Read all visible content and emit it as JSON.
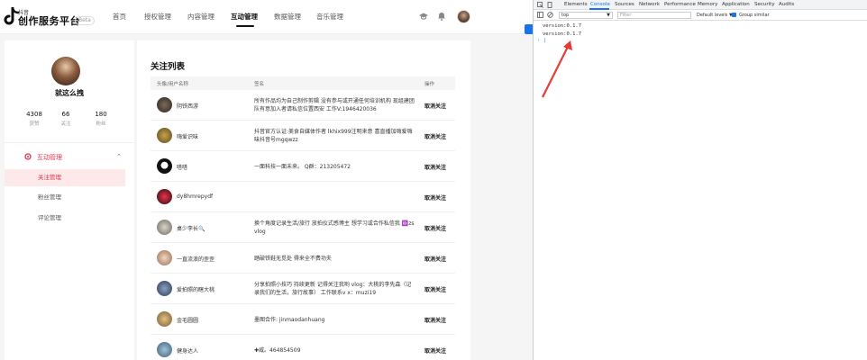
{
  "brand": {
    "small": "抖音",
    "title": "创作服务平台",
    "badge": "Beta"
  },
  "nav": {
    "items": [
      "首页",
      "授权管理",
      "内容管理",
      "互动管理",
      "数据管理",
      "音乐管理"
    ],
    "active_index": 3
  },
  "topbar_icons": [
    "graduation-cap-icon",
    "bell-icon"
  ],
  "profile": {
    "name": "就这么拽",
    "stats": [
      {
        "value": "4308",
        "label": "获赞"
      },
      {
        "value": "66",
        "label": "关注"
      },
      {
        "value": "180",
        "label": "粉丝"
      }
    ]
  },
  "sidemenu": {
    "head": "互动管理",
    "items": [
      "关注管理",
      "粉丝管理",
      "评论管理"
    ],
    "active_index": 0
  },
  "main": {
    "title": "关注列表",
    "headers": {
      "avatar": "头像/用户名称",
      "signature": "签名",
      "action": "操作"
    },
    "rows": [
      {
        "name": "阴铁西游",
        "signature": "所有作品均为自己制作剪辑 没有参与或开通任何培训机构 现组建团队有意加入者请私信位置西安 工作V:1946420036",
        "action": "取消关注"
      },
      {
        "name": "嗨爱识味",
        "signature": "抖音官方认证:美食自媒体作者 lkhix999注明来意 喜直播加嗨爱嗨味抖音号mgqwzz",
        "action": "取消关注"
      },
      {
        "name": "嗒嗒",
        "signature": "一面科技一面未来。 Q群：213205472",
        "action": "取消关注"
      },
      {
        "name": "dy8hmrepydf",
        "signature": "",
        "action": "取消关注"
      },
      {
        "name": "桌少李长🔍",
        "signature": "换个角度记录生活/旅行 放拍仪式感博主 想学习或合作私信我 🆔zsvlog",
        "action": "取消关注"
      },
      {
        "name": "一直流浪的歪歪",
        "signature": "踏破铁鞋无觅处 得来全不费功夫",
        "action": "取消关注"
      },
      {
        "name": "爱拍照的瞎大桃",
        "signature": "分享拍照小技巧 持续更新 记得关注我哟 vlog：大桃的李先森（记录我们的生活，旅行故事） 工作联系v x：muzi19",
        "action": "取消关注"
      },
      {
        "name": "金毛圆圆",
        "signature": "墨图合作: jinmaodanhuang",
        "action": "取消关注"
      },
      {
        "name": "健身达人",
        "signature": "✚威。464854509",
        "action": "取消关注"
      }
    ]
  },
  "devtools": {
    "tabs": [
      "Elements",
      "Console",
      "Sources",
      "Network",
      "Performance",
      "Memory",
      "Application",
      "Security",
      "Audits"
    ],
    "active_tab": 1,
    "context": "top",
    "filter_placeholder": "Filter",
    "levels": "Default levels ▼",
    "group_similar": "Group similar",
    "console_lines": [
      "version:0.1.7",
      "version:0.1.7"
    ],
    "prompt": "› |"
  },
  "colors": {
    "accent": "#e8334a",
    "devtools_blue": "#1a73e8",
    "annotation_arrow": "#e53935"
  }
}
